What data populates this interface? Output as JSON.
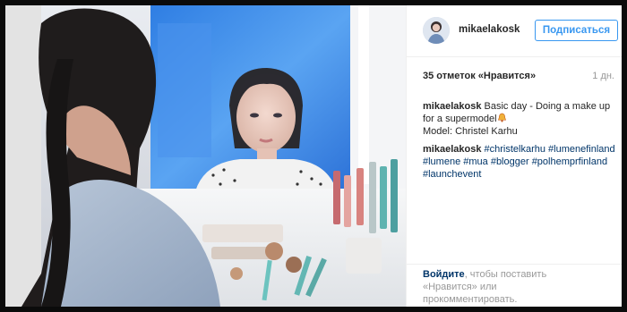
{
  "post": {
    "username": "mikaelakosk",
    "follow_label": "Подписаться",
    "likes": "35 отметок «Нравится»",
    "time": "1 дн.",
    "caption": {
      "author": "mikaelakosk",
      "text_line": "Basic day - Doing a make up for a supermodel",
      "model_line": "Model: Christel Karhu"
    },
    "hashtag_comment": {
      "author": "mikaelakosk",
      "hashtags": "#christelkarhu #lumenefinland #lumene #mua #blogger #polhemprfinland #launchevent"
    },
    "footer": {
      "login": "Войдите",
      "rest": ", чтобы поставить «Нравится» или прокомментировать."
    }
  },
  "colors": {
    "accent": "#3897f0",
    "link": "#003569",
    "muted": "#999999"
  },
  "icons": [
    "bell-emoji-icon"
  ]
}
